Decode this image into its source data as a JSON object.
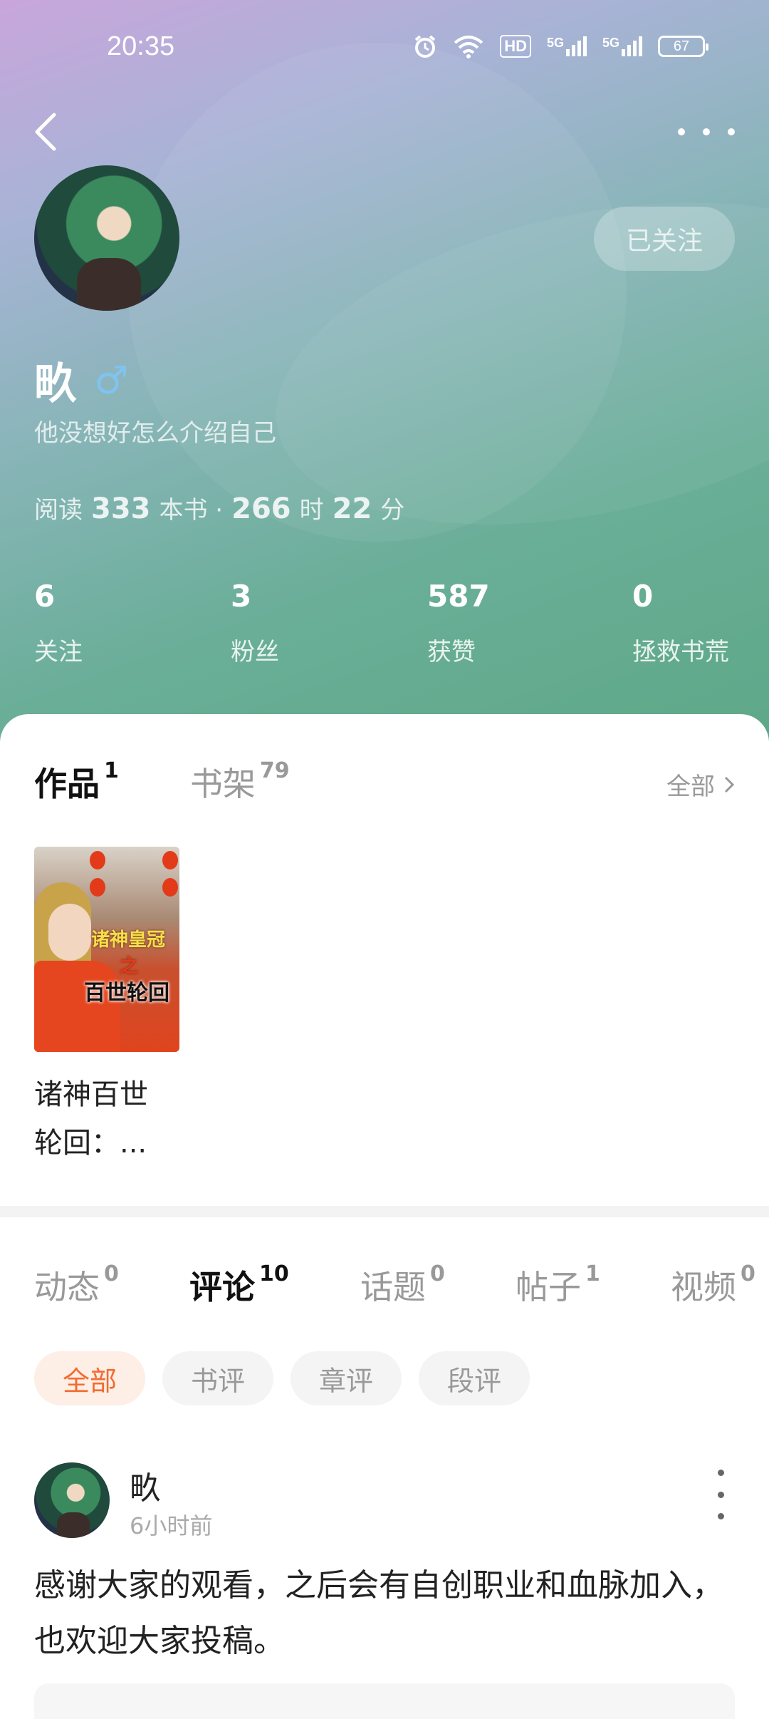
{
  "status_bar": {
    "time": "20:35",
    "icons": [
      "alarm-icon",
      "wifi-icon",
      "hd-icon",
      "signal-5g-icon",
      "signal-5g-icon"
    ],
    "hd_label": "HD",
    "signal1_label": "5G",
    "signal2_label": "5G",
    "battery": "67"
  },
  "profile": {
    "follow_button": "已关注",
    "username": "畂",
    "gender_symbol": "♂",
    "bio": "他没想好怎么介绍自己",
    "reading": {
      "prefix": "阅读",
      "books": "333",
      "books_unit": "本书 ·",
      "hours": "266",
      "hours_unit": "时",
      "minutes": "22",
      "minutes_unit": "分"
    },
    "stats": [
      {
        "value": "6",
        "label": "关注"
      },
      {
        "value": "3",
        "label": "粉丝"
      },
      {
        "value": "587",
        "label": "获赞"
      },
      {
        "value": "0",
        "label": "拯救书荒"
      }
    ]
  },
  "works": {
    "tabs": [
      {
        "label": "作品",
        "count": "1"
      },
      {
        "label": "书架",
        "count": "79"
      }
    ],
    "view_all": "全部",
    "book": {
      "cover_title": "百世轮回",
      "cover_top": "诸神皇冠",
      "cover_mid": "之",
      "name_line1": "诸神百世",
      "name_line2": "轮回：..."
    }
  },
  "activity": {
    "tabs": [
      {
        "label": "动态",
        "count": "0"
      },
      {
        "label": "评论",
        "count": "10"
      },
      {
        "label": "话题",
        "count": "0"
      },
      {
        "label": "帖子",
        "count": "1"
      },
      {
        "label": "视频",
        "count": "0"
      }
    ],
    "chips": [
      "全部",
      "书评",
      "章评",
      "段评"
    ],
    "comment": {
      "user": "畂",
      "time": "6小时前",
      "text": "感谢大家的观看，之后会有自创职业和血脉加入，也欢迎大家投稿。"
    }
  },
  "colors": {
    "accent": "#f26b2f",
    "chip_active_bg": "#fdeee6"
  }
}
